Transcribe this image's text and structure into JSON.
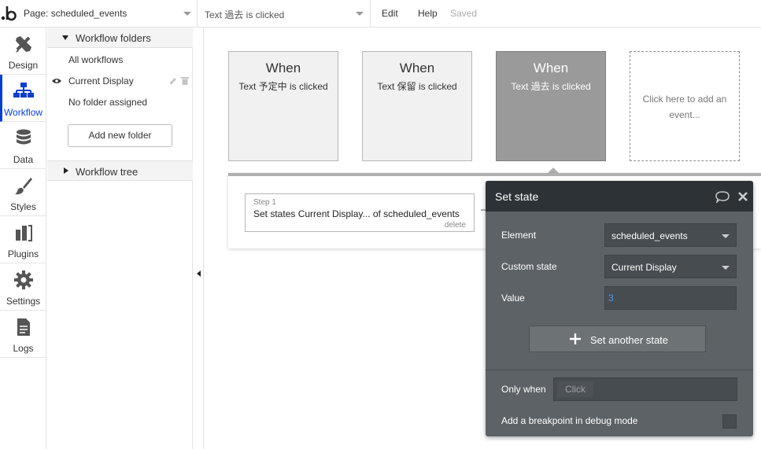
{
  "topbar": {
    "page_label": "Page: scheduled_events",
    "workflow_label": "Text 過去 is clicked",
    "menu_edit": "Edit",
    "menu_help": "Help",
    "status": "Saved"
  },
  "rail": {
    "items": [
      {
        "label": "Design",
        "icon": "design-icon"
      },
      {
        "label": "Workflow",
        "icon": "workflow-icon",
        "active": true
      },
      {
        "label": "Data",
        "icon": "database-icon"
      },
      {
        "label": "Styles",
        "icon": "brush-icon"
      },
      {
        "label": "Plugins",
        "icon": "plugin-icon"
      },
      {
        "label": "Settings",
        "icon": "gear-icon"
      },
      {
        "label": "Logs",
        "icon": "document-icon"
      }
    ]
  },
  "folders": {
    "header": "Workflow folders",
    "items": [
      "All workflows",
      "Current Display",
      "No folder assigned"
    ],
    "add_button": "Add new folder",
    "tree_header": "Workflow tree"
  },
  "events": [
    {
      "when": "When",
      "label": "Text 予定中 is clicked"
    },
    {
      "when": "When",
      "label": "Text 保留 is clicked"
    },
    {
      "when": "When",
      "label": "Text 過去 is clicked",
      "selected": true
    }
  ],
  "add_event": {
    "line1": "Click here to add an",
    "line2": "event..."
  },
  "step": {
    "number": "Step 1",
    "description": "Set states Current Display... of scheduled_events",
    "delete": "delete"
  },
  "panel": {
    "title": "Set state",
    "element_label": "Element",
    "element_value": "scheduled_events",
    "custom_state_label": "Custom state",
    "custom_state_value": "Current Display",
    "value_label": "Value",
    "value_value": "3",
    "set_another": "Set another state",
    "only_when_label": "Only when",
    "only_when_placeholder": "Click",
    "breakpoint_label": "Add a breakpoint in debug mode"
  },
  "colors": {
    "accent": "#0d3fc8",
    "panel_bg": "#5d6266",
    "panel_head": "#2d3236",
    "selected_event": "#9a9a9a",
    "value_text": "#3aa0ff"
  }
}
